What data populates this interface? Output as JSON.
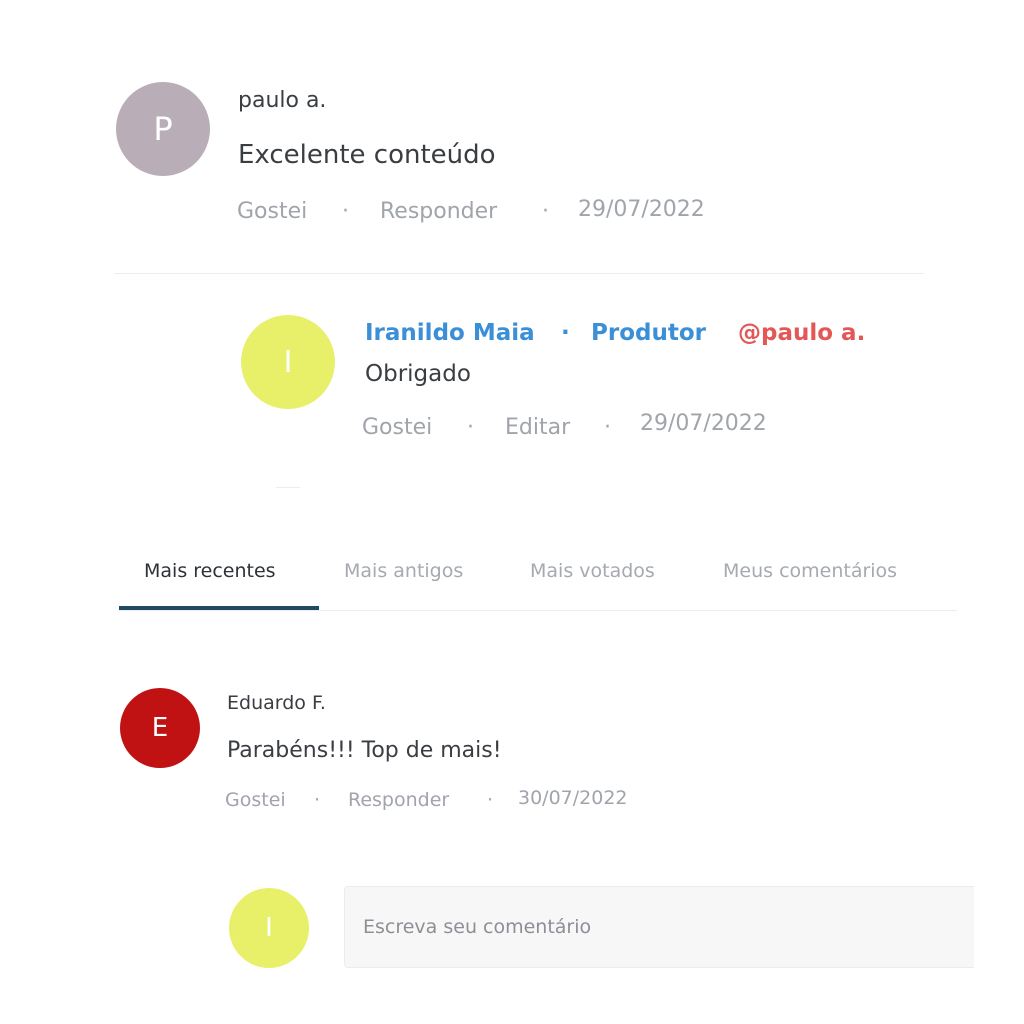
{
  "comments": [
    {
      "avatar_initial": "P",
      "avatar_color": "#b9aeb7",
      "author": "paulo a.",
      "text": "Excelente conteúdo",
      "like_label": "Gostei",
      "reply_label": "Responder",
      "separator": "·",
      "date": "29/07/2022"
    },
    {
      "avatar_initial": "E",
      "avatar_color": "#c01212",
      "author": "Eduardo F.",
      "text": "Parabéns!!! Top de mais!",
      "like_label": "Gostei",
      "reply_label": "Responder",
      "separator": "·",
      "date": "30/07/2022"
    }
  ],
  "reply": {
    "avatar_initial": "I",
    "avatar_color": "#e8f06a",
    "author": "Iranildo Maia",
    "role_separator": "·",
    "role": "Produtor",
    "mention": "@paulo a.",
    "text": "Obrigado",
    "like_label": "Gostei",
    "edit_label": "Editar",
    "separator": "·",
    "date": "29/07/2022"
  },
  "tabs": [
    {
      "label": "Mais recentes",
      "active": true
    },
    {
      "label": "Mais antigos",
      "active": false
    },
    {
      "label": "Mais votados",
      "active": false
    },
    {
      "label": "Meus comentários",
      "active": false
    }
  ],
  "composer": {
    "avatar_initial": "I",
    "avatar_color": "#e8f06a",
    "placeholder": "Escreva seu comentário",
    "value": ""
  },
  "colors": {
    "author_link": "#3b8fd6",
    "mention": "#e35757",
    "tab_underline": "#1f4a63",
    "meta_text": "#a0a4ab"
  }
}
